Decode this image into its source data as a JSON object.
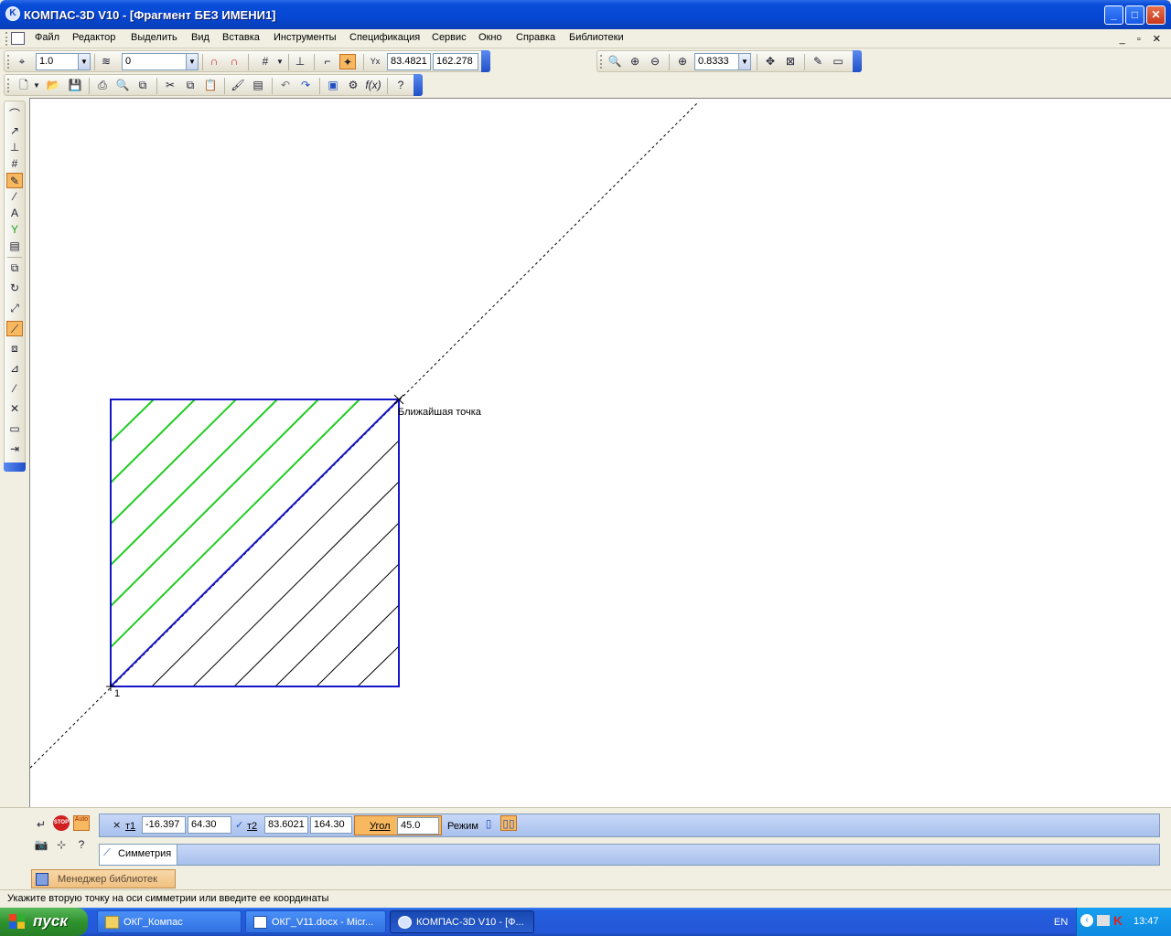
{
  "window": {
    "title": "КОМПАС-3D V10 - [Фрагмент БЕЗ ИМЕНИ1]"
  },
  "menu": [
    "Файл",
    "Редактор",
    "Выделить",
    "Вид",
    "Вставка",
    "Инструменты",
    "Спецификация",
    "Сервис",
    "Окно",
    "Справка",
    "Библиотеки"
  ],
  "toolbar": {
    "scale": "1.0",
    "layer": "0",
    "coord_x": "83.4821",
    "coord_y": "162.278",
    "zoom": "0.8333"
  },
  "canvas": {
    "snap_hint": "Ближайшая точка",
    "point_label": "1"
  },
  "props": {
    "t1_label": "т1",
    "t1_x": "-16.397",
    "t1_y": "64.30",
    "t2_label": "т2",
    "t2_x": "83.6021",
    "t2_y": "164.30",
    "angle_label": "Угол",
    "angle_value": "45.0",
    "mode_label": "Режим",
    "tab_label": "Симметрия",
    "auto_label": "Auto",
    "stop_label": "STOP"
  },
  "library_manager": "Менеджер библиотек",
  "status": "Укажите вторую точку на оси симметрии или введите ее координаты",
  "taskbar": {
    "start": "пуск",
    "items": [
      "ОКГ_Компас",
      "ОКГ_V11.docx - Micr...",
      "КОМПАС-3D V10 - [Ф..."
    ],
    "lang": "EN",
    "time": "13:47"
  },
  "colors": {
    "outline": "#1414c8",
    "hatch_green": "#22cc22",
    "axis": "#000000"
  }
}
